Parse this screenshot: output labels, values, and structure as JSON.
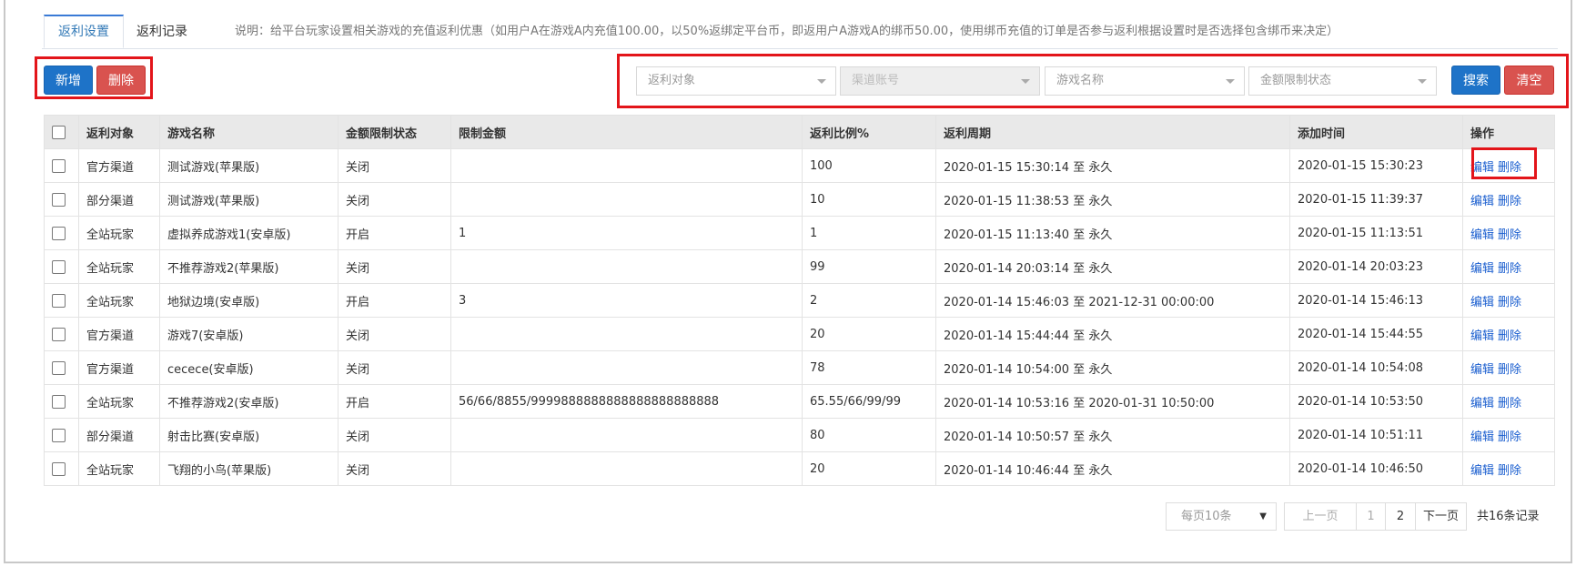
{
  "tabs": {
    "active": "返利设置",
    "second": "返利记录",
    "description": "说明：给平台玩家设置相关游戏的充值返利优惠（如用户A在游戏A内充值100.00，以50%返绑定平台币，即返用户A游戏A的绑币50.00，使用绑币充值的订单是否参与返利根据设置时是否选择包含绑币来决定）"
  },
  "toolbar": {
    "add": "新增",
    "delete": "删除"
  },
  "filters": {
    "target": "返利对象",
    "channel": "渠道账号",
    "game": "游戏名称",
    "limit_status": "金额限制状态",
    "search": "搜索",
    "clear": "清空"
  },
  "table": {
    "headers": [
      "返利对象",
      "游戏名称",
      "金额限制状态",
      "限制金额",
      "返利比例%",
      "返利周期",
      "添加时间",
      "操作"
    ],
    "edit": "编辑",
    "remove": "删除",
    "rows": [
      {
        "target": "官方渠道",
        "game": "测试游戏(苹果版)",
        "status": "关闭",
        "on": false,
        "amount": "",
        "ratio": "100",
        "period": "2020-01-15 15:30:14 至 永久",
        "added": "2020-01-15 15:30:23"
      },
      {
        "target": "部分渠道",
        "game": "测试游戏(苹果版)",
        "status": "关闭",
        "on": false,
        "amount": "",
        "ratio": "10",
        "period": "2020-01-15 11:38:53 至 永久",
        "added": "2020-01-15 11:39:37"
      },
      {
        "target": "全站玩家",
        "game": "虚拟养成游戏1(安卓版)",
        "status": "开启",
        "on": true,
        "amount": "1",
        "ratio": "1",
        "period": "2020-01-15 11:13:40 至 永久",
        "added": "2020-01-15 11:13:51"
      },
      {
        "target": "全站玩家",
        "game": "不推荐游戏2(苹果版)",
        "status": "关闭",
        "on": false,
        "amount": "",
        "ratio": "99",
        "period": "2020-01-14 20:03:14 至 永久",
        "added": "2020-01-14 20:03:23"
      },
      {
        "target": "全站玩家",
        "game": "地狱边境(安卓版)",
        "status": "开启",
        "on": true,
        "amount": "3",
        "ratio": "2",
        "period": "2020-01-14 15:46:03 至 2021-12-31 00:00:00",
        "added": "2020-01-14 15:46:13"
      },
      {
        "target": "官方渠道",
        "game": "游戏7(安卓版)",
        "status": "关闭",
        "on": false,
        "amount": "",
        "ratio": "20",
        "period": "2020-01-14 15:44:44 至 永久",
        "added": "2020-01-14 15:44:55"
      },
      {
        "target": "官方渠道",
        "game": "cecece(安卓版)",
        "status": "关闭",
        "on": false,
        "amount": "",
        "ratio": "78",
        "period": "2020-01-14 10:54:00 至 永久",
        "added": "2020-01-14 10:54:08"
      },
      {
        "target": "全站玩家",
        "game": "不推荐游戏2(安卓版)",
        "status": "开启",
        "on": true,
        "amount": "56/66/8855/9999888888888888888888888",
        "ratio": "65.55/66/99/99",
        "period": "2020-01-14 10:53:16 至 2020-01-31 10:50:00",
        "added": "2020-01-14 10:53:50"
      },
      {
        "target": "部分渠道",
        "game": "射击比赛(安卓版)",
        "status": "关闭",
        "on": false,
        "amount": "",
        "ratio": "80",
        "period": "2020-01-14 10:50:57 至 永久",
        "added": "2020-01-14 10:51:11"
      },
      {
        "target": "全站玩家",
        "game": "飞翔的小鸟(苹果版)",
        "status": "关闭",
        "on": false,
        "amount": "",
        "ratio": "20",
        "period": "2020-01-14 10:46:44 至 永久",
        "added": "2020-01-14 10:46:50"
      }
    ]
  },
  "pagination": {
    "page_size": "每页10条",
    "prev": "上一页",
    "pages": [
      "1",
      "2"
    ],
    "next": "下一页",
    "total": "共16条记录"
  },
  "colors": {
    "primary": "#1e73c8",
    "danger": "#d9534f",
    "highlight": "#e3151a",
    "status_on": "#1a3fd1"
  }
}
